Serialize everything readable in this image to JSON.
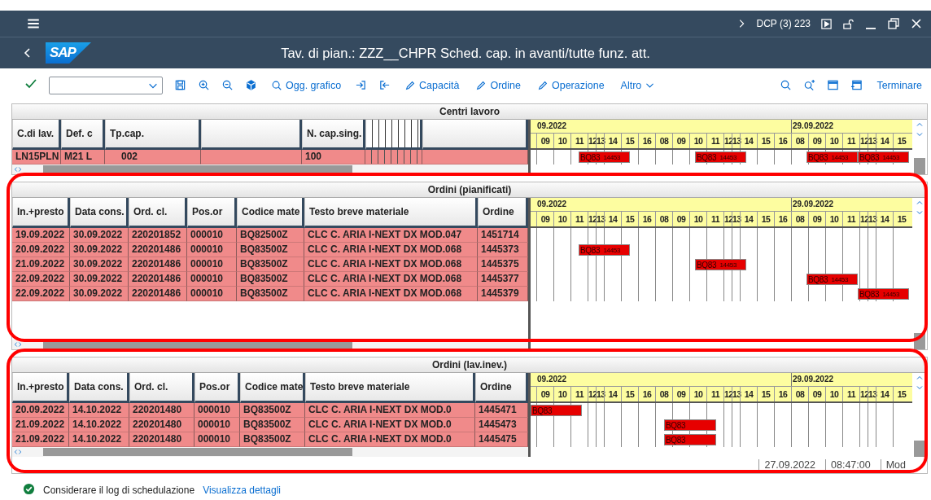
{
  "shell": {
    "system": "DCP (3) 223"
  },
  "header": {
    "logo": "SAP",
    "title": "Tav. di pian.: ZZZ__CHPR Sched. cap. in avanti/tutte funz. att."
  },
  "toolbar": {
    "buttons": [
      {
        "kind": "search",
        "label": "Ogg. grafico"
      },
      {
        "kind": "pencil",
        "label": "Capacità"
      },
      {
        "kind": "pencil",
        "label": "Ordine"
      },
      {
        "kind": "pencil",
        "label": "Operazione"
      },
      {
        "kind": "menu",
        "label": "Altro"
      }
    ],
    "exit": "Terminare"
  },
  "sections": [
    {
      "title": "Centri lavoro",
      "columns": [
        {
          "kind": "text",
          "label": "C.di lav."
        },
        {
          "kind": "text",
          "label": "Def. c"
        },
        {
          "kind": "text",
          "label": "Tp.cap."
        },
        {
          "kind": "blank"
        },
        {
          "kind": "text",
          "label": "N. cap.sing."
        },
        {
          "kind": "lines"
        },
        {
          "kind": "blank"
        }
      ],
      "rows": [
        {
          "cells": [
            "LN15PLN",
            "M21 L",
            "002",
            "100"
          ],
          "bars": [
            {
              "label": "BQ83",
              "order": "14453"
            },
            {
              "label": "BQ83",
              "order": "14453"
            },
            {
              "label": "BQ83",
              "order": "14453"
            },
            {
              "label": "BQ83",
              "order": "14453"
            }
          ]
        }
      ],
      "days": [
        {
          "label": "09.2022",
          "hours": [
            "09",
            "10",
            "11",
            "12",
            "13",
            "14",
            "15",
            "16"
          ]
        },
        {
          "hours": [
            "08",
            "09",
            "10",
            "11",
            "12",
            "13",
            "14",
            "15",
            "16"
          ]
        },
        {
          "label": "29.09.2022",
          "hours": [
            "08",
            "09",
            "10",
            "11",
            "12",
            "13",
            "14",
            "15"
          ]
        }
      ]
    },
    {
      "title": "Ordini (pianificati)",
      "columns": [
        {
          "kind": "text",
          "label": "In.+presto"
        },
        {
          "kind": "text",
          "label": "Data cons."
        },
        {
          "kind": "text",
          "label": "Ord. cl."
        },
        {
          "kind": "text",
          "label": "Pos.or"
        },
        {
          "kind": "text",
          "label": "Codice mate"
        },
        {
          "kind": "text",
          "label": "Testo breve materiale"
        },
        {
          "kind": "text",
          "label": "Ordine"
        }
      ],
      "rows": [
        {
          "cells": [
            "19.09.2022",
            "30.09.2022",
            "220201852",
            "000010",
            "BQ82500Z",
            "CLC C. ARIA I-NEXT DX MOD.047",
            "1451714"
          ]
        },
        {
          "cells": [
            "20.09.2022",
            "30.09.2022",
            "220201486",
            "000010",
            "BQ83500Z",
            "CLC C. ARIA I-NEXT DX MOD.068",
            "1445373"
          ],
          "bars": [
            {
              "label": "BQ83",
              "order": "14453"
            }
          ]
        },
        {
          "cells": [
            "21.09.2022",
            "30.09.2022",
            "220201486",
            "000010",
            "BQ83500Z",
            "CLC C. ARIA I-NEXT DX MOD.068",
            "1445375"
          ],
          "bars": [
            {
              "label": "BQ83",
              "order": "14453"
            }
          ]
        },
        {
          "cells": [
            "22.09.2022",
            "30.09.2022",
            "220201486",
            "000010",
            "BQ83500Z",
            "CLC C. ARIA I-NEXT DX MOD.068",
            "1445377"
          ],
          "bars": [
            {
              "label": "BQ83",
              "order": "14453"
            }
          ]
        },
        {
          "cells": [
            "22.09.2022",
            "30.09.2022",
            "220201486",
            "000010",
            "BQ83500Z",
            "CLC C. ARIA I-NEXT DX MOD.068",
            "1445379"
          ],
          "bars": [
            {
              "label": "BQ83",
              "order": "14453"
            }
          ]
        }
      ],
      "days": [
        {
          "label": "09.2022",
          "hours": [
            "09",
            "10",
            "11",
            "12",
            "13",
            "14",
            "15",
            "16"
          ]
        },
        {
          "hours": [
            "08",
            "09",
            "10",
            "11",
            "12",
            "13",
            "14",
            "15",
            "16"
          ]
        },
        {
          "label": "29.09.2022",
          "hours": [
            "08",
            "09",
            "10",
            "11",
            "12",
            "13",
            "14",
            "15"
          ]
        }
      ]
    },
    {
      "title": "Ordini (lav.inev.)",
      "columns": [
        {
          "kind": "text",
          "label": "In.+presto"
        },
        {
          "kind": "text",
          "label": "Data cons."
        },
        {
          "kind": "text",
          "label": "Ord. cl."
        },
        {
          "kind": "text",
          "label": "Pos.or"
        },
        {
          "kind": "text",
          "label": "Codice mate"
        },
        {
          "kind": "text",
          "label": "Testo breve materiale"
        },
        {
          "kind": "text",
          "label": "Ordine"
        }
      ],
      "rows": [
        {
          "cells": [
            "20.09.2022",
            "14.10.2022",
            "220201480",
            "000010",
            "BQ83500Z",
            "CLC C. ARIA I-NEXT DX MOD.0",
            "1445471"
          ],
          "bars": [
            {
              "label": "BQ83"
            }
          ]
        },
        {
          "cells": [
            "21.09.2022",
            "14.10.2022",
            "220201480",
            "000010",
            "BQ83500Z",
            "CLC C. ARIA I-NEXT DX MOD.0",
            "1445473"
          ],
          "bars": [
            {
              "label": "BQ83"
            }
          ]
        },
        {
          "cells": [
            "21.09.2022",
            "14.10.2022",
            "220201480",
            "000010",
            "BQ83500Z",
            "CLC C. ARIA I-NEXT DX MOD.0",
            "1445475"
          ],
          "bars": [
            {
              "label": "BQ83"
            }
          ]
        }
      ],
      "days": [
        {
          "label": "09.2022",
          "hours": [
            "09",
            "10",
            "11",
            "12",
            "13",
            "14",
            "15",
            "16"
          ]
        },
        {
          "hours": [
            "08",
            "09",
            "10",
            "11",
            "12",
            "13",
            "14",
            "15",
            "16"
          ]
        },
        {
          "label": "29.09.2022",
          "hours": [
            "08",
            "09",
            "10",
            "11",
            "12",
            "13",
            "14",
            "15"
          ]
        }
      ],
      "status": [
        "27.09.2022",
        "08:47:00",
        "Mod"
      ]
    }
  ],
  "footer": {
    "message": "Considerare il log di schedulazione",
    "link": "Visualizza dettagli"
  }
}
